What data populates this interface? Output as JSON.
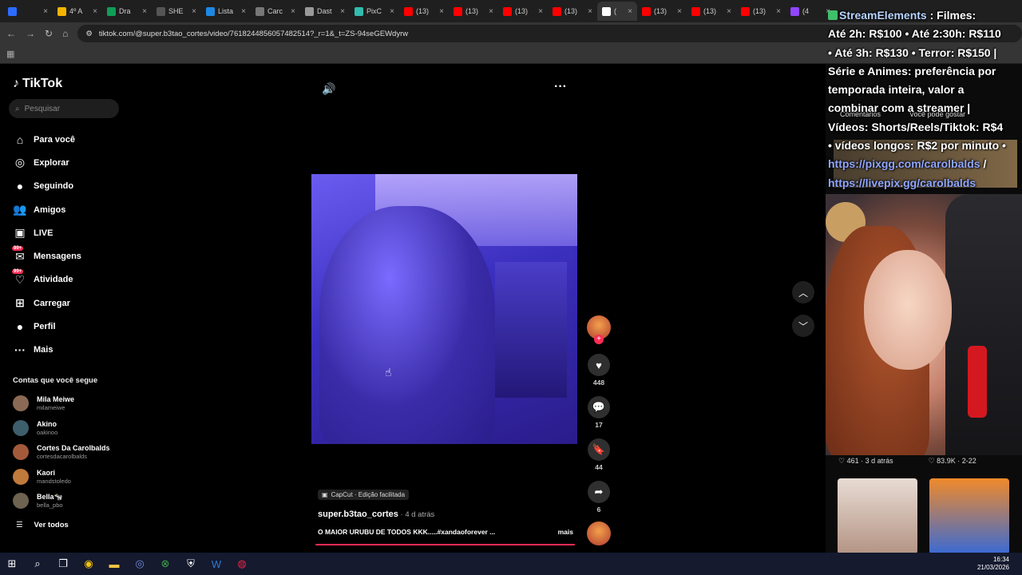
{
  "browser": {
    "tabs": [
      {
        "label": "",
        "icon": "diamond-icon",
        "color": "#2b6cff"
      },
      {
        "label": "4º A",
        "icon": "drive-icon",
        "color": "#f4b400"
      },
      {
        "label": "Dra",
        "icon": "drive-icon",
        "color": "#0f9d58"
      },
      {
        "label": "SHE",
        "icon": "s-icon",
        "color": "#555555"
      },
      {
        "label": "Lista",
        "icon": "cloud-icon",
        "color": "#1e88e5"
      },
      {
        "label": "Carc",
        "icon": "gear-icon",
        "color": "#777777"
      },
      {
        "label": "Dast",
        "icon": "globe-icon",
        "color": "#999999"
      },
      {
        "label": "PixC",
        "icon": "pix-icon",
        "color": "#32bcad"
      },
      {
        "label": "(13)",
        "icon": "youtube-icon",
        "color": "#ff0000"
      },
      {
        "label": "(13)",
        "icon": "youtube-icon",
        "color": "#ff0000"
      },
      {
        "label": "(13)",
        "icon": "youtube-icon",
        "color": "#ff0000"
      },
      {
        "label": "(13)",
        "icon": "youtube-icon",
        "color": "#ff0000"
      },
      {
        "label": "(",
        "icon": "tiktok-icon",
        "color": "#ffffff",
        "active": true
      },
      {
        "label": "(13)",
        "icon": "youtube-icon",
        "color": "#ff0000"
      },
      {
        "label": "(13)",
        "icon": "youtube-icon",
        "color": "#ff0000"
      },
      {
        "label": "(13)",
        "icon": "youtube-icon",
        "color": "#ff0000"
      },
      {
        "label": "(4",
        "icon": "twitch-icon",
        "color": "#9146ff"
      }
    ],
    "url": "tiktok.com/@super.b3tao_cortes/video/7618244856057482514?_r=1&_t=ZS-94seGEWdyrw"
  },
  "sidebar": {
    "logo": "TikTok",
    "search_placeholder": "Pesquisar",
    "nav": [
      {
        "label": "Para você",
        "icon": "home-icon"
      },
      {
        "label": "Explorar",
        "icon": "compass-icon"
      },
      {
        "label": "Seguindo",
        "icon": "following-avatar-icon"
      },
      {
        "label": "Amigos",
        "icon": "friends-icon"
      },
      {
        "label": "LIVE",
        "icon": "live-icon"
      },
      {
        "label": "Mensagens",
        "icon": "messages-icon",
        "badge": "99+"
      },
      {
        "label": "Atividade",
        "icon": "activity-icon",
        "badge": "99+"
      },
      {
        "label": "Carregar",
        "icon": "upload-icon"
      },
      {
        "label": "Perfil",
        "icon": "profile-avatar-icon"
      },
      {
        "label": "Mais",
        "icon": "more-icon"
      }
    ],
    "following_title": "Contas que você segue",
    "following": [
      {
        "name": "Mila Meiwe",
        "user": "milameiwe",
        "color": "#8a6a55"
      },
      {
        "name": "Akino",
        "user": "oakinoo",
        "color": "#3d5e6b"
      },
      {
        "name": "Cortes Da Carolbalds",
        "user": "cortesdacarolbalds",
        "color": "#a35a3a"
      },
      {
        "name": "Kaori",
        "user": "mandstoledo",
        "color": "#c07a3b"
      },
      {
        "name": "Bella🐄",
        "user": "bella_pbo",
        "color": "#6e6250"
      }
    ],
    "see_all": "Ver todos"
  },
  "video": {
    "capcut": "CapCut · Edição facilitada",
    "author": "super.b3tao_cortes",
    "ago": " · 4 d atrás",
    "description": "O MAIOR URUBU DE TODOS KKK.....#xandaoforever ...",
    "more": "mais",
    "likes": "448",
    "comments": "17",
    "saves": "44",
    "shares": "6"
  },
  "right_panel": {
    "tab_comments": "Comentários",
    "tab_suggest": "Você pode gostar",
    "stat_left": "♡ 461 · 3 d atrás",
    "stat_right": "♡ 83.9K · 2-22"
  },
  "overlay": {
    "brand": "StreamElements",
    "line1": " : Filmes:",
    "line2": "Até 2h: R$100 • Até 2:30h: R$110",
    "line3": "• Até 3h: R$130 • Terror: R$150 |",
    "line4": "Série e Animes: preferência por",
    "line5": "temporada inteira, valor a",
    "line6": "combinar com a streamer |",
    "line7": "Vídeos: Shorts/Reels/Tiktok: R$4",
    "line8": "• vídeos longos: R$2 por minuto •",
    "link1": "https://pixgg.com/carolbalds",
    "link1_tail": " /",
    "link2": "https://livepix.gg/carolbalds"
  },
  "taskbar": {
    "time": "16:34",
    "date": "21/03/2026"
  }
}
